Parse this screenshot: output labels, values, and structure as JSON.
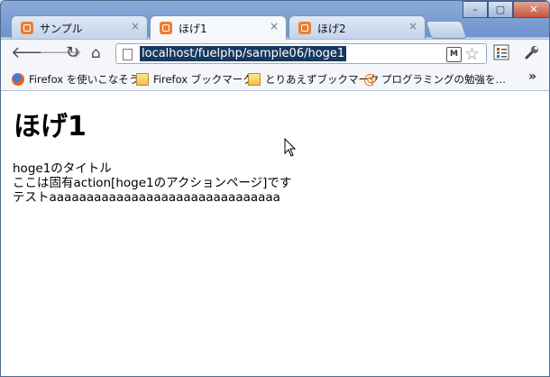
{
  "tabs": [
    {
      "title": "サンプル",
      "active": false
    },
    {
      "title": "ほげ1",
      "active": true
    },
    {
      "title": "ほげ2",
      "active": false
    }
  ],
  "tab_close_glyph": "×",
  "omnibox": {
    "url": "localhost/fuelphp/sample06/hoge1",
    "ext_label": "M"
  },
  "bookmarks": [
    {
      "label": "Firefox を使いこなそう",
      "icon": "firefox-icon"
    },
    {
      "label": "Firefox ブックマーク",
      "icon": "folder-icon"
    },
    {
      "label": "とりあえずブックマーク",
      "icon": "folder-icon"
    },
    {
      "label": "プログラミングの勉強を…",
      "icon": "at-icon"
    }
  ],
  "page": {
    "heading": "ほげ1",
    "lines": [
      "hoge1のタイトル",
      "ここは固有action[hoge1のアクションページ]です",
      "テストaaaaaaaaaaaaaaaaaaaaaaaaaaaaaaa"
    ]
  }
}
